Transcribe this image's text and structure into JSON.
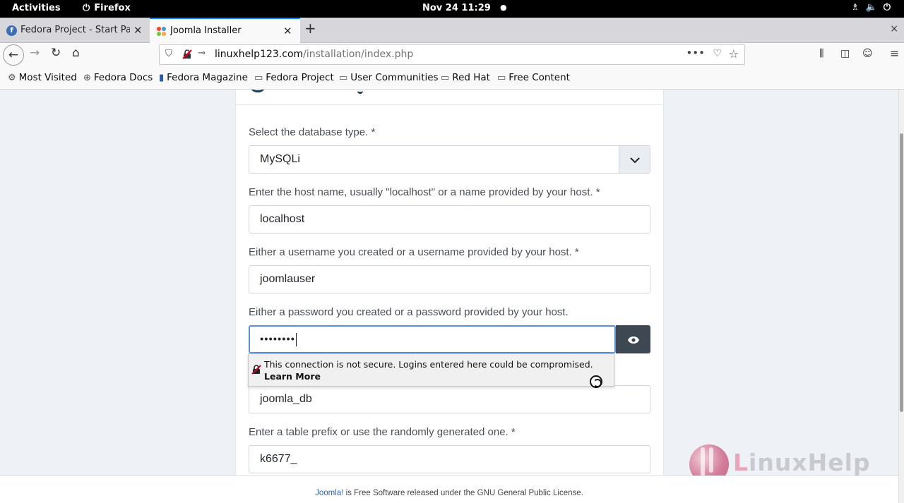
{
  "system_bar": {
    "activities": "Activities",
    "app_name": "Firefox",
    "clock": "Nov 24  11:29",
    "dot": "●",
    "tray_icons": [
      "network-icon",
      "volume-icon",
      "power-icon"
    ]
  },
  "tabs": [
    {
      "label": "Fedora Project - Start Pa",
      "favicon": "fedora-icon",
      "active": false
    },
    {
      "label": "Joomla Installer",
      "favicon": "joomla-icon",
      "active": true
    }
  ],
  "tab_close": "✕",
  "new_tab": "+",
  "window_close": "×",
  "nav": {
    "url_domain": "linuxhelp123.com",
    "url_path": "/installation/index.php",
    "more": "•••"
  },
  "bookmarks": [
    {
      "label": "Most Visited",
      "icon": "gear-icon"
    },
    {
      "label": "Fedora Docs",
      "icon": "globe-icon"
    },
    {
      "label": "Fedora Magazine",
      "icon": "fm-icon"
    },
    {
      "label": "Fedora Project",
      "icon": "folder-icon"
    },
    {
      "label": "User Communities",
      "icon": "folder-icon"
    },
    {
      "label": "Red Hat",
      "icon": "folder-icon"
    },
    {
      "label": "Free Content",
      "icon": "folder-icon"
    }
  ],
  "form": {
    "db_type_label": "Select the database type. *",
    "db_type_value": "MySQLi",
    "host_label": "Enter the host name, usually \"localhost\" or a name provided by your host. *",
    "host_value": "localhost",
    "user_label": "Either a username you created or a username provided by your host. *",
    "user_value": "joomlauser",
    "password_label": "Either a password you created or a password provided by your host.",
    "password_value": "••••••••",
    "dbname_value": "joomla_db",
    "prefix_label": "Enter a table prefix or use the randomly generated one. *",
    "prefix_value": "k6677_"
  },
  "popup": {
    "message": "This connection is not secure. Logins entered here could be compromised.",
    "learn_more": "Learn More"
  },
  "watermark": {
    "text_l": "L",
    "text_rest": "inuxHelp"
  },
  "footer": {
    "link": "Joomla!",
    "text": " is Free Software released under the GNU General Public License."
  },
  "colors": {
    "accent": "#0a84ff",
    "focus_border": "#5b8fd8",
    "eye_button": "#3d4852",
    "page_bg": "#eef1f6"
  }
}
